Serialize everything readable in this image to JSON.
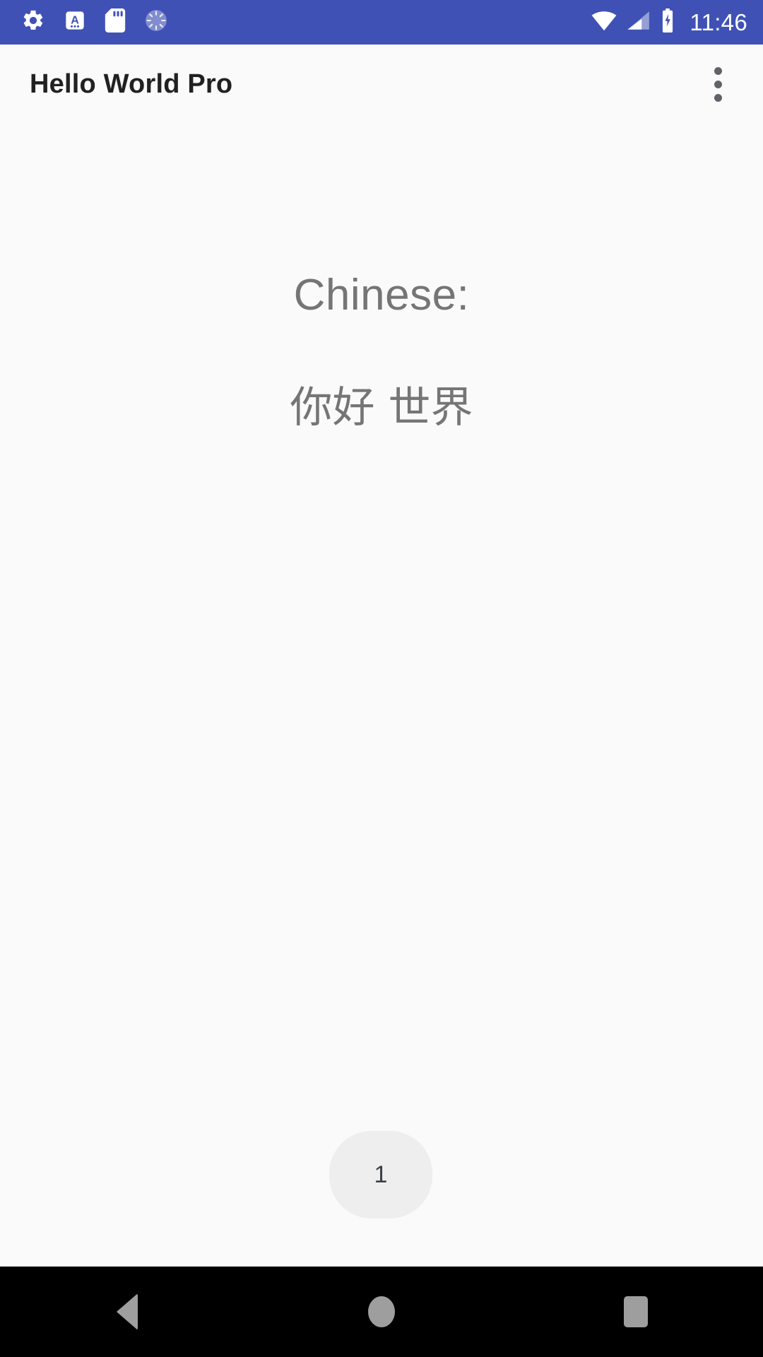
{
  "status_bar": {
    "background_color": "#3f51b5",
    "time": "11:46",
    "notification_icons": [
      {
        "name": "settings-gear-icon",
        "label": "Settings"
      },
      {
        "name": "input-method-icon",
        "label": "A"
      },
      {
        "name": "sd-card-icon",
        "label": "SD card"
      },
      {
        "name": "loading-spinner-icon",
        "label": "Loading"
      }
    ],
    "system_icons": [
      {
        "name": "wifi-icon",
        "label": "Wi-Fi full signal"
      },
      {
        "name": "cellular-signal-icon",
        "label": "Cellular 2 of 4 bars"
      },
      {
        "name": "battery-charging-icon",
        "label": "Battery charging"
      }
    ]
  },
  "app_bar": {
    "title": "Hello World Pro",
    "overflow_menu_label": "More options",
    "background_color": "#fafafa",
    "title_color": "#212121"
  },
  "main": {
    "language_label": "Chinese:",
    "greeting_text": "你好 世界",
    "text_color": "#757575"
  },
  "counter_button": {
    "value": "1",
    "background_color": "#eeeeee",
    "text_color": "#3c4043"
  },
  "nav_bar": {
    "background_color": "#000000",
    "icon_color": "#9e9e9e",
    "buttons": [
      {
        "name": "nav-back-button",
        "label": "Back"
      },
      {
        "name": "nav-home-button",
        "label": "Home"
      },
      {
        "name": "nav-recents-button",
        "label": "Recent apps"
      }
    ]
  }
}
